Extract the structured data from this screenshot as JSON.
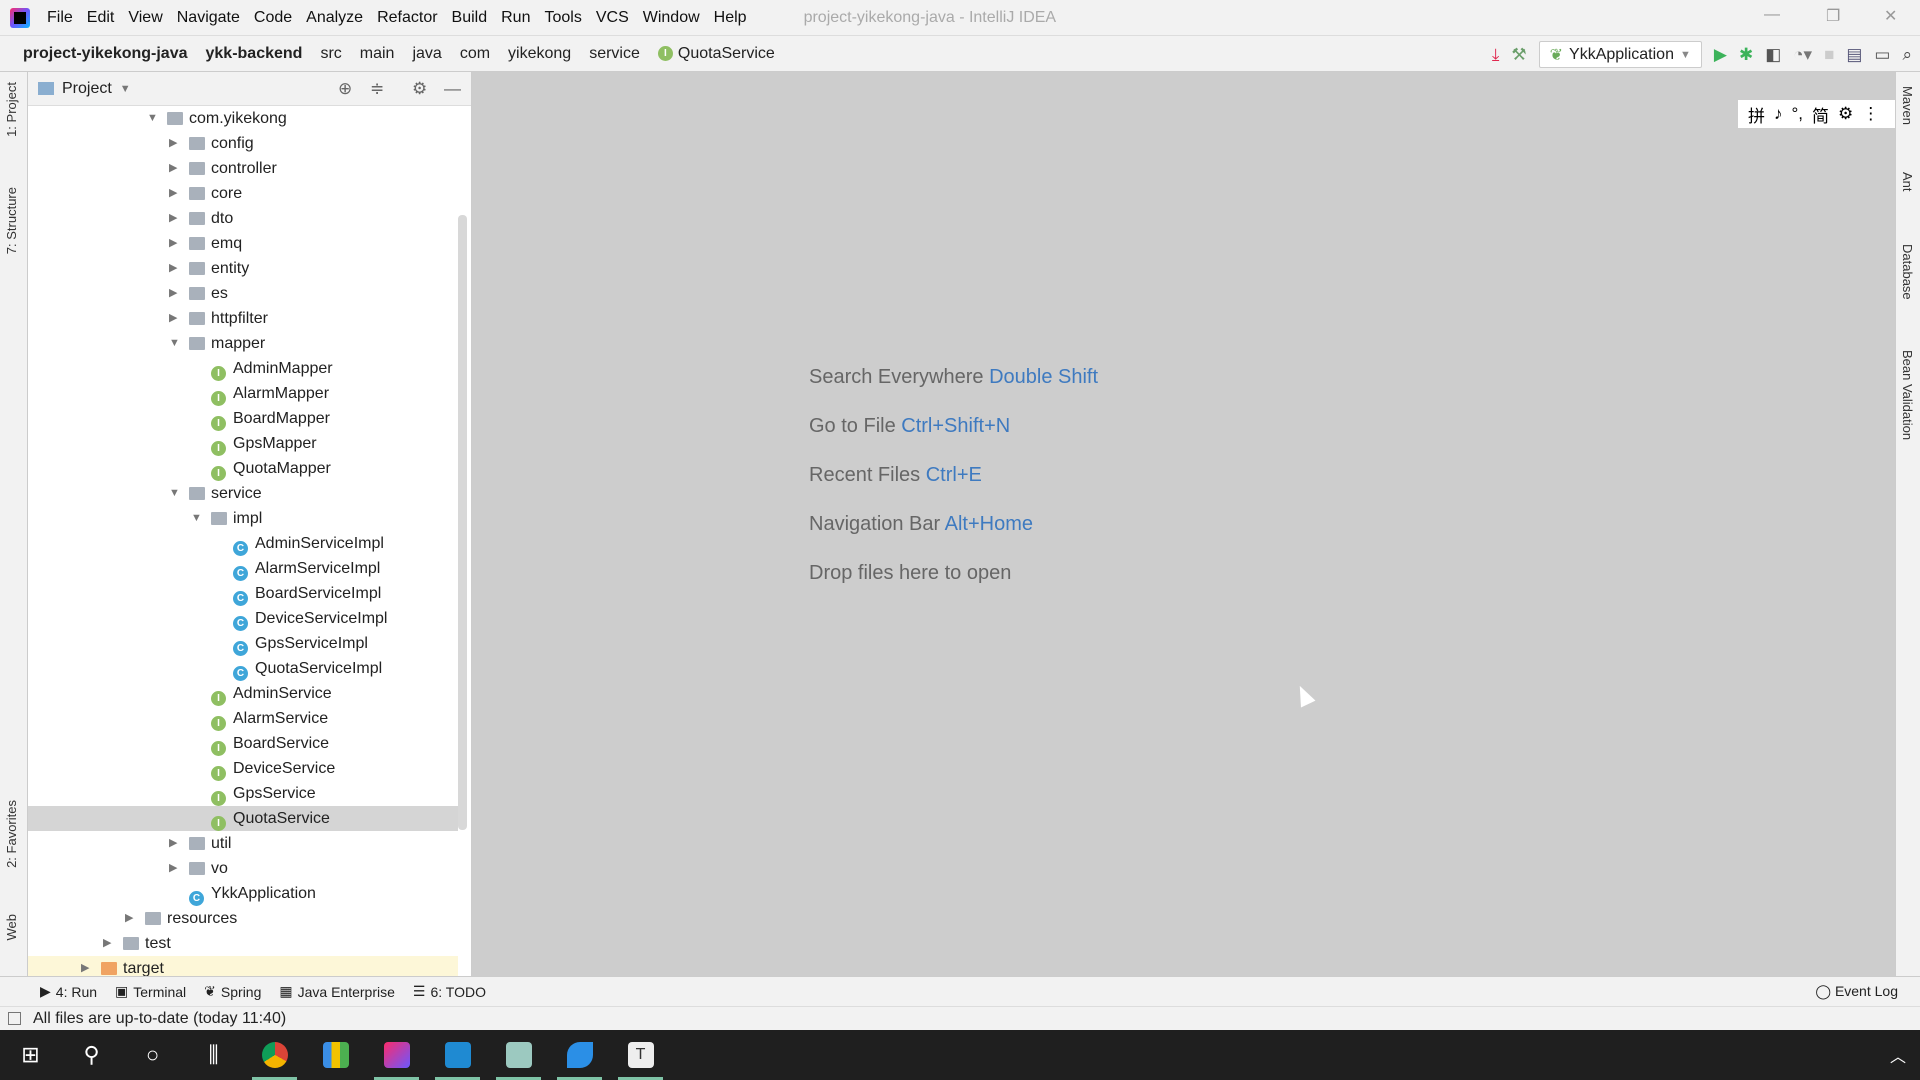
{
  "titlebar": {
    "menus": [
      "File",
      "Edit",
      "View",
      "Navigate",
      "Code",
      "Analyze",
      "Refactor",
      "Build",
      "Run",
      "Tools",
      "VCS",
      "Window",
      "Help"
    ],
    "title": "project-yikekong-java - IntelliJ IDEA",
    "min": "—",
    "max": "❐",
    "close": "✕"
  },
  "navbar": {
    "crumbs": [
      "project-yikekong-java",
      "ykk-backend",
      "src",
      "main",
      "java",
      "com",
      "yikekong",
      "service"
    ],
    "current_file": "QuotaService",
    "run_config": "YkkApplication"
  },
  "left_tabs": [
    "1: Project",
    "7: Structure",
    "2: Favorites",
    "Web"
  ],
  "right_tabs": [
    "Maven",
    "Ant",
    "Database",
    "Bean Validation"
  ],
  "project_panel": {
    "title": "Project",
    "tree": [
      {
        "label": "com.yikekong",
        "depth": 3,
        "type": "folder",
        "state": "open"
      },
      {
        "label": "config",
        "depth": 4,
        "type": "folder",
        "state": "closed"
      },
      {
        "label": "controller",
        "depth": 4,
        "type": "folder",
        "state": "closed"
      },
      {
        "label": "core",
        "depth": 4,
        "type": "folder",
        "state": "closed"
      },
      {
        "label": "dto",
        "depth": 4,
        "type": "folder",
        "state": "closed"
      },
      {
        "label": "emq",
        "depth": 4,
        "type": "folder",
        "state": "closed"
      },
      {
        "label": "entity",
        "depth": 4,
        "type": "folder",
        "state": "closed"
      },
      {
        "label": "es",
        "depth": 4,
        "type": "folder",
        "state": "closed"
      },
      {
        "label": "httpfilter",
        "depth": 4,
        "type": "folder",
        "state": "closed"
      },
      {
        "label": "mapper",
        "depth": 4,
        "type": "folder",
        "state": "open"
      },
      {
        "label": "AdminMapper",
        "depth": 5,
        "type": "interface"
      },
      {
        "label": "AlarmMapper",
        "depth": 5,
        "type": "interface"
      },
      {
        "label": "BoardMapper",
        "depth": 5,
        "type": "interface"
      },
      {
        "label": "GpsMapper",
        "depth": 5,
        "type": "interface"
      },
      {
        "label": "QuotaMapper",
        "depth": 5,
        "type": "interface"
      },
      {
        "label": "service",
        "depth": 4,
        "type": "folder",
        "state": "open"
      },
      {
        "label": "impl",
        "depth": 5,
        "type": "folder",
        "state": "open"
      },
      {
        "label": "AdminServiceImpl",
        "depth": 6,
        "type": "class"
      },
      {
        "label": "AlarmServiceImpl",
        "depth": 6,
        "type": "class"
      },
      {
        "label": "BoardServiceImpl",
        "depth": 6,
        "type": "class"
      },
      {
        "label": "DeviceServiceImpl",
        "depth": 6,
        "type": "class"
      },
      {
        "label": "GpsServiceImpl",
        "depth": 6,
        "type": "class"
      },
      {
        "label": "QuotaServiceImpl",
        "depth": 6,
        "type": "class"
      },
      {
        "label": "AdminService",
        "depth": 5,
        "type": "interface"
      },
      {
        "label": "AlarmService",
        "depth": 5,
        "type": "interface"
      },
      {
        "label": "BoardService",
        "depth": 5,
        "type": "interface"
      },
      {
        "label": "DeviceService",
        "depth": 5,
        "type": "interface"
      },
      {
        "label": "GpsService",
        "depth": 5,
        "type": "interface"
      },
      {
        "label": "QuotaService",
        "depth": 5,
        "type": "interface",
        "selected": true
      },
      {
        "label": "util",
        "depth": 4,
        "type": "folder",
        "state": "closed"
      },
      {
        "label": "vo",
        "depth": 4,
        "type": "folder",
        "state": "closed"
      },
      {
        "label": "YkkApplication",
        "depth": 4,
        "type": "spring-class"
      },
      {
        "label": "resources",
        "depth": 2,
        "type": "folder",
        "state": "closed"
      },
      {
        "label": "test",
        "depth": 1,
        "type": "folder",
        "state": "closed"
      },
      {
        "label": "target",
        "depth": 0,
        "type": "excluded-folder",
        "state": "closed"
      }
    ]
  },
  "editor": {
    "hints": [
      {
        "text": "Search Everywhere",
        "key": "Double Shift"
      },
      {
        "text": "Go to File",
        "key": "Ctrl+Shift+N"
      },
      {
        "text": "Recent Files",
        "key": "Ctrl+E"
      },
      {
        "text": "Navigation Bar",
        "key": "Alt+Home"
      },
      {
        "text": "Drop files here to open",
        "key": ""
      }
    ]
  },
  "ime": [
    "拼",
    "♪",
    "°,",
    "简",
    "⚙",
    "⋮"
  ],
  "bottom_tabs": [
    {
      "label": "4: Run",
      "icon": "▶"
    },
    {
      "label": "Terminal",
      "icon": "▣"
    },
    {
      "label": "Spring",
      "icon": "❦"
    },
    {
      "label": "Java Enterprise",
      "icon": "▦"
    },
    {
      "label": "6: TODO",
      "icon": "☰"
    }
  ],
  "event_log": "Event Log",
  "status": "All files are up-to-date (today 11:40)",
  "colors": {
    "accent": "#3e7ac0",
    "editor_bg": "#cdcdcd",
    "selection": "#d5d5d5"
  }
}
